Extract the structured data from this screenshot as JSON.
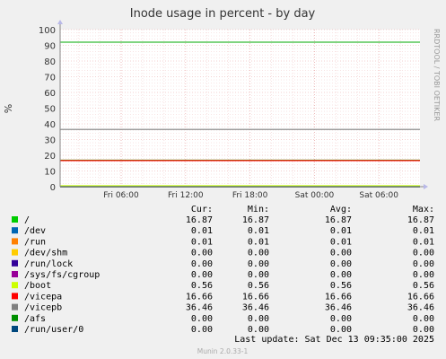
{
  "chart_data": {
    "type": "line",
    "title": "Inode usage in percent - by day",
    "ylabel": "%",
    "watermark": "RRDTOOL / TOBI OETIKER",
    "ylim": [
      0,
      100
    ],
    "y_ticks": [
      "0",
      "10",
      "20",
      "30",
      "40",
      "50",
      "60",
      "70",
      "80",
      "90",
      "100"
    ],
    "x_ticks": [
      "Fri 06:00",
      "Fri 12:00",
      "Fri 18:00",
      "Sat 00:00",
      "Sat 06:00"
    ],
    "grid": true,
    "hrule_value": 92,
    "columns": [
      "Cur:",
      "Min:",
      "Avg:",
      "Max:"
    ],
    "series": [
      {
        "name": "/",
        "color": "#00cc00",
        "cur": "16.87",
        "min": "16.87",
        "avg": "16.87",
        "max": "16.87"
      },
      {
        "name": "/dev",
        "color": "#0066b3",
        "cur": "0.01",
        "min": "0.01",
        "avg": "0.01",
        "max": "0.01"
      },
      {
        "name": "/run",
        "color": "#ff8000",
        "cur": "0.01",
        "min": "0.01",
        "avg": "0.01",
        "max": "0.01"
      },
      {
        "name": "/dev/shm",
        "color": "#ffcc00",
        "cur": "0.00",
        "min": "0.00",
        "avg": "0.00",
        "max": "0.00"
      },
      {
        "name": "/run/lock",
        "color": "#330099",
        "cur": "0.00",
        "min": "0.00",
        "avg": "0.00",
        "max": "0.00"
      },
      {
        "name": "/sys/fs/cgroup",
        "color": "#990099",
        "cur": "0.00",
        "min": "0.00",
        "avg": "0.00",
        "max": "0.00"
      },
      {
        "name": "/boot",
        "color": "#ccff00",
        "cur": "0.56",
        "min": "0.56",
        "avg": "0.56",
        "max": "0.56"
      },
      {
        "name": "/vicepa",
        "color": "#ff0000",
        "cur": "16.66",
        "min": "16.66",
        "avg": "16.66",
        "max": "16.66"
      },
      {
        "name": "/vicepb",
        "color": "#808080",
        "cur": "36.46",
        "min": "36.46",
        "avg": "36.46",
        "max": "36.46"
      },
      {
        "name": "/afs",
        "color": "#008f00",
        "cur": "0.00",
        "min": "0.00",
        "avg": "0.00",
        "max": "0.00"
      },
      {
        "name": "/run/user/0",
        "color": "#00487d",
        "cur": "0.00",
        "min": "0.00",
        "avg": "0.00",
        "max": "0.00"
      }
    ]
  },
  "footer": {
    "last_update": "Last update:  Sat Dec 13 09:35:00 2025",
    "version": "Munin 2.0.33-1"
  }
}
